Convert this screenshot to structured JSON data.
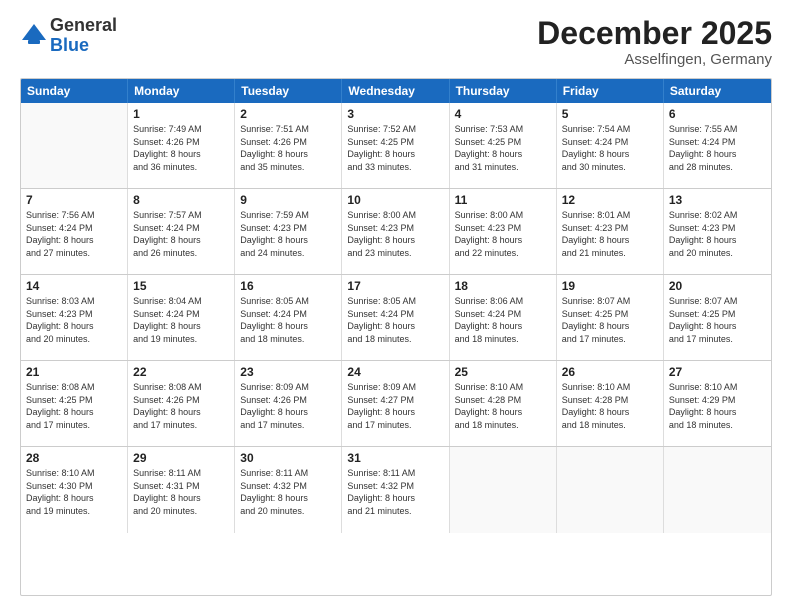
{
  "logo": {
    "general": "General",
    "blue": "Blue"
  },
  "title": "December 2025",
  "subtitle": "Asselfingen, Germany",
  "header_days": [
    "Sunday",
    "Monday",
    "Tuesday",
    "Wednesday",
    "Thursday",
    "Friday",
    "Saturday"
  ],
  "weeks": [
    [
      {
        "day": "",
        "sunrise": "",
        "sunset": "",
        "daylight": "",
        "empty": true
      },
      {
        "day": "1",
        "sunrise": "Sunrise: 7:49 AM",
        "sunset": "Sunset: 4:26 PM",
        "daylight": "Daylight: 8 hours",
        "daylight2": "and 36 minutes."
      },
      {
        "day": "2",
        "sunrise": "Sunrise: 7:51 AM",
        "sunset": "Sunset: 4:26 PM",
        "daylight": "Daylight: 8 hours",
        "daylight2": "and 35 minutes."
      },
      {
        "day": "3",
        "sunrise": "Sunrise: 7:52 AM",
        "sunset": "Sunset: 4:25 PM",
        "daylight": "Daylight: 8 hours",
        "daylight2": "and 33 minutes."
      },
      {
        "day": "4",
        "sunrise": "Sunrise: 7:53 AM",
        "sunset": "Sunset: 4:25 PM",
        "daylight": "Daylight: 8 hours",
        "daylight2": "and 31 minutes."
      },
      {
        "day": "5",
        "sunrise": "Sunrise: 7:54 AM",
        "sunset": "Sunset: 4:24 PM",
        "daylight": "Daylight: 8 hours",
        "daylight2": "and 30 minutes."
      },
      {
        "day": "6",
        "sunrise": "Sunrise: 7:55 AM",
        "sunset": "Sunset: 4:24 PM",
        "daylight": "Daylight: 8 hours",
        "daylight2": "and 28 minutes."
      }
    ],
    [
      {
        "day": "7",
        "sunrise": "Sunrise: 7:56 AM",
        "sunset": "Sunset: 4:24 PM",
        "daylight": "Daylight: 8 hours",
        "daylight2": "and 27 minutes."
      },
      {
        "day": "8",
        "sunrise": "Sunrise: 7:57 AM",
        "sunset": "Sunset: 4:24 PM",
        "daylight": "Daylight: 8 hours",
        "daylight2": "and 26 minutes."
      },
      {
        "day": "9",
        "sunrise": "Sunrise: 7:59 AM",
        "sunset": "Sunset: 4:23 PM",
        "daylight": "Daylight: 8 hours",
        "daylight2": "and 24 minutes."
      },
      {
        "day": "10",
        "sunrise": "Sunrise: 8:00 AM",
        "sunset": "Sunset: 4:23 PM",
        "daylight": "Daylight: 8 hours",
        "daylight2": "and 23 minutes."
      },
      {
        "day": "11",
        "sunrise": "Sunrise: 8:00 AM",
        "sunset": "Sunset: 4:23 PM",
        "daylight": "Daylight: 8 hours",
        "daylight2": "and 22 minutes."
      },
      {
        "day": "12",
        "sunrise": "Sunrise: 8:01 AM",
        "sunset": "Sunset: 4:23 PM",
        "daylight": "Daylight: 8 hours",
        "daylight2": "and 21 minutes."
      },
      {
        "day": "13",
        "sunrise": "Sunrise: 8:02 AM",
        "sunset": "Sunset: 4:23 PM",
        "daylight": "Daylight: 8 hours",
        "daylight2": "and 20 minutes."
      }
    ],
    [
      {
        "day": "14",
        "sunrise": "Sunrise: 8:03 AM",
        "sunset": "Sunset: 4:23 PM",
        "daylight": "Daylight: 8 hours",
        "daylight2": "and 20 minutes."
      },
      {
        "day": "15",
        "sunrise": "Sunrise: 8:04 AM",
        "sunset": "Sunset: 4:24 PM",
        "daylight": "Daylight: 8 hours",
        "daylight2": "and 19 minutes."
      },
      {
        "day": "16",
        "sunrise": "Sunrise: 8:05 AM",
        "sunset": "Sunset: 4:24 PM",
        "daylight": "Daylight: 8 hours",
        "daylight2": "and 18 minutes."
      },
      {
        "day": "17",
        "sunrise": "Sunrise: 8:05 AM",
        "sunset": "Sunset: 4:24 PM",
        "daylight": "Daylight: 8 hours",
        "daylight2": "and 18 minutes."
      },
      {
        "day": "18",
        "sunrise": "Sunrise: 8:06 AM",
        "sunset": "Sunset: 4:24 PM",
        "daylight": "Daylight: 8 hours",
        "daylight2": "and 18 minutes."
      },
      {
        "day": "19",
        "sunrise": "Sunrise: 8:07 AM",
        "sunset": "Sunset: 4:25 PM",
        "daylight": "Daylight: 8 hours",
        "daylight2": "and 17 minutes."
      },
      {
        "day": "20",
        "sunrise": "Sunrise: 8:07 AM",
        "sunset": "Sunset: 4:25 PM",
        "daylight": "Daylight: 8 hours",
        "daylight2": "and 17 minutes."
      }
    ],
    [
      {
        "day": "21",
        "sunrise": "Sunrise: 8:08 AM",
        "sunset": "Sunset: 4:25 PM",
        "daylight": "Daylight: 8 hours",
        "daylight2": "and 17 minutes."
      },
      {
        "day": "22",
        "sunrise": "Sunrise: 8:08 AM",
        "sunset": "Sunset: 4:26 PM",
        "daylight": "Daylight: 8 hours",
        "daylight2": "and 17 minutes."
      },
      {
        "day": "23",
        "sunrise": "Sunrise: 8:09 AM",
        "sunset": "Sunset: 4:26 PM",
        "daylight": "Daylight: 8 hours",
        "daylight2": "and 17 minutes."
      },
      {
        "day": "24",
        "sunrise": "Sunrise: 8:09 AM",
        "sunset": "Sunset: 4:27 PM",
        "daylight": "Daylight: 8 hours",
        "daylight2": "and 17 minutes."
      },
      {
        "day": "25",
        "sunrise": "Sunrise: 8:10 AM",
        "sunset": "Sunset: 4:28 PM",
        "daylight": "Daylight: 8 hours",
        "daylight2": "and 18 minutes."
      },
      {
        "day": "26",
        "sunrise": "Sunrise: 8:10 AM",
        "sunset": "Sunset: 4:28 PM",
        "daylight": "Daylight: 8 hours",
        "daylight2": "and 18 minutes."
      },
      {
        "day": "27",
        "sunrise": "Sunrise: 8:10 AM",
        "sunset": "Sunset: 4:29 PM",
        "daylight": "Daylight: 8 hours",
        "daylight2": "and 18 minutes."
      }
    ],
    [
      {
        "day": "28",
        "sunrise": "Sunrise: 8:10 AM",
        "sunset": "Sunset: 4:30 PM",
        "daylight": "Daylight: 8 hours",
        "daylight2": "and 19 minutes."
      },
      {
        "day": "29",
        "sunrise": "Sunrise: 8:11 AM",
        "sunset": "Sunset: 4:31 PM",
        "daylight": "Daylight: 8 hours",
        "daylight2": "and 20 minutes."
      },
      {
        "day": "30",
        "sunrise": "Sunrise: 8:11 AM",
        "sunset": "Sunset: 4:32 PM",
        "daylight": "Daylight: 8 hours",
        "daylight2": "and 20 minutes."
      },
      {
        "day": "31",
        "sunrise": "Sunrise: 8:11 AM",
        "sunset": "Sunset: 4:32 PM",
        "daylight": "Daylight: 8 hours",
        "daylight2": "and 21 minutes."
      },
      {
        "day": "",
        "sunrise": "",
        "sunset": "",
        "daylight": "",
        "daylight2": "",
        "empty": true
      },
      {
        "day": "",
        "sunrise": "",
        "sunset": "",
        "daylight": "",
        "daylight2": "",
        "empty": true
      },
      {
        "day": "",
        "sunrise": "",
        "sunset": "",
        "daylight": "",
        "daylight2": "",
        "empty": true
      }
    ]
  ]
}
